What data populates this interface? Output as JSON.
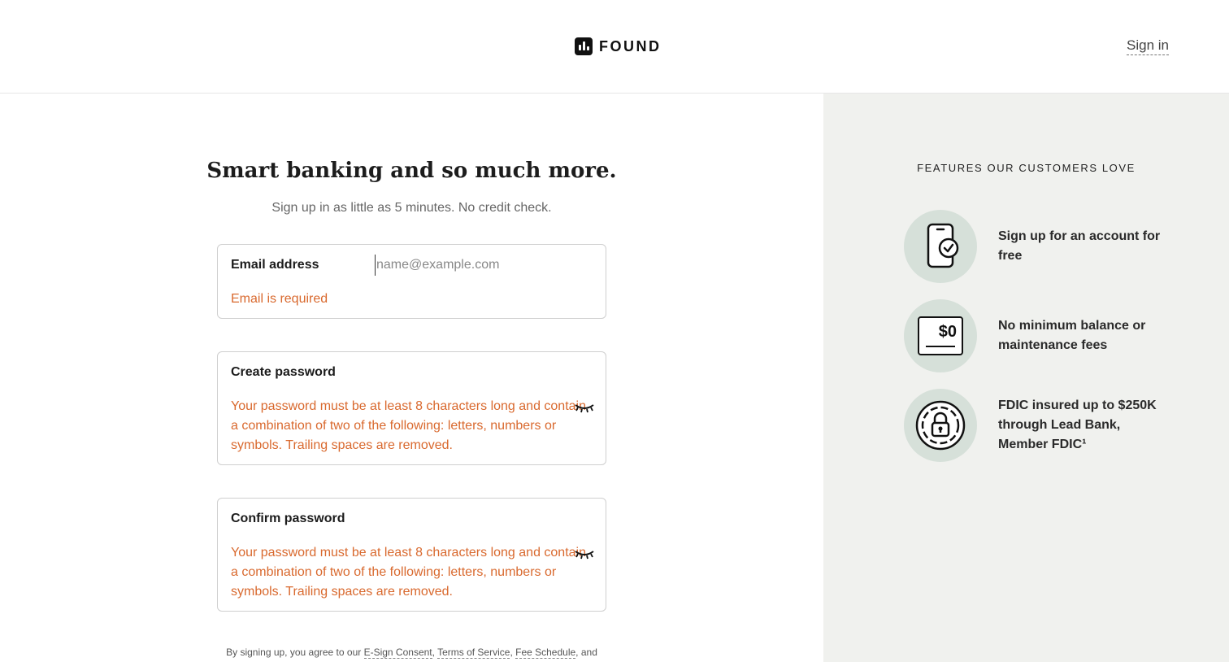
{
  "header": {
    "brand": "FOUND",
    "signin_label": "Sign in"
  },
  "main": {
    "headline": "Smart banking and so much more.",
    "subhead": "Sign up in as little as 5 minutes. No credit check.",
    "email": {
      "label": "Email address",
      "placeholder": "name@example.com",
      "value": "",
      "error": "Email is required"
    },
    "create_password": {
      "label": "Create password",
      "error": "Your password must be at least 8 characters long and contain a combination of two of the following: letters, numbers or symbols. Trailing spaces are removed."
    },
    "confirm_password": {
      "label": "Confirm password",
      "error": "Your password must be at least 8 characters long and contain a combination of two of the following: letters, numbers or symbols. Trailing spaces are removed."
    },
    "legal": {
      "prefix": "By signing up, you agree to our",
      "links": [
        "E-Sign Consent",
        "Terms of Service",
        "Fee Schedule"
      ],
      "suffix": "and"
    }
  },
  "features": {
    "title": "FEATURES OUR CUSTOMERS LOVE",
    "items": [
      {
        "icon": "phone-check-icon",
        "text": "Sign up for an account for free"
      },
      {
        "icon": "zero-dollar-icon",
        "text": "No minimum balance or maintenance fees",
        "badge": "$0"
      },
      {
        "icon": "lock-icon",
        "text": "FDIC insured up to $250K through Lead Bank, Member FDIC¹"
      }
    ]
  },
  "colors": {
    "error": "#d9692e",
    "panel": "#f0f1ee",
    "icon_circle": "#d6e0d9"
  }
}
